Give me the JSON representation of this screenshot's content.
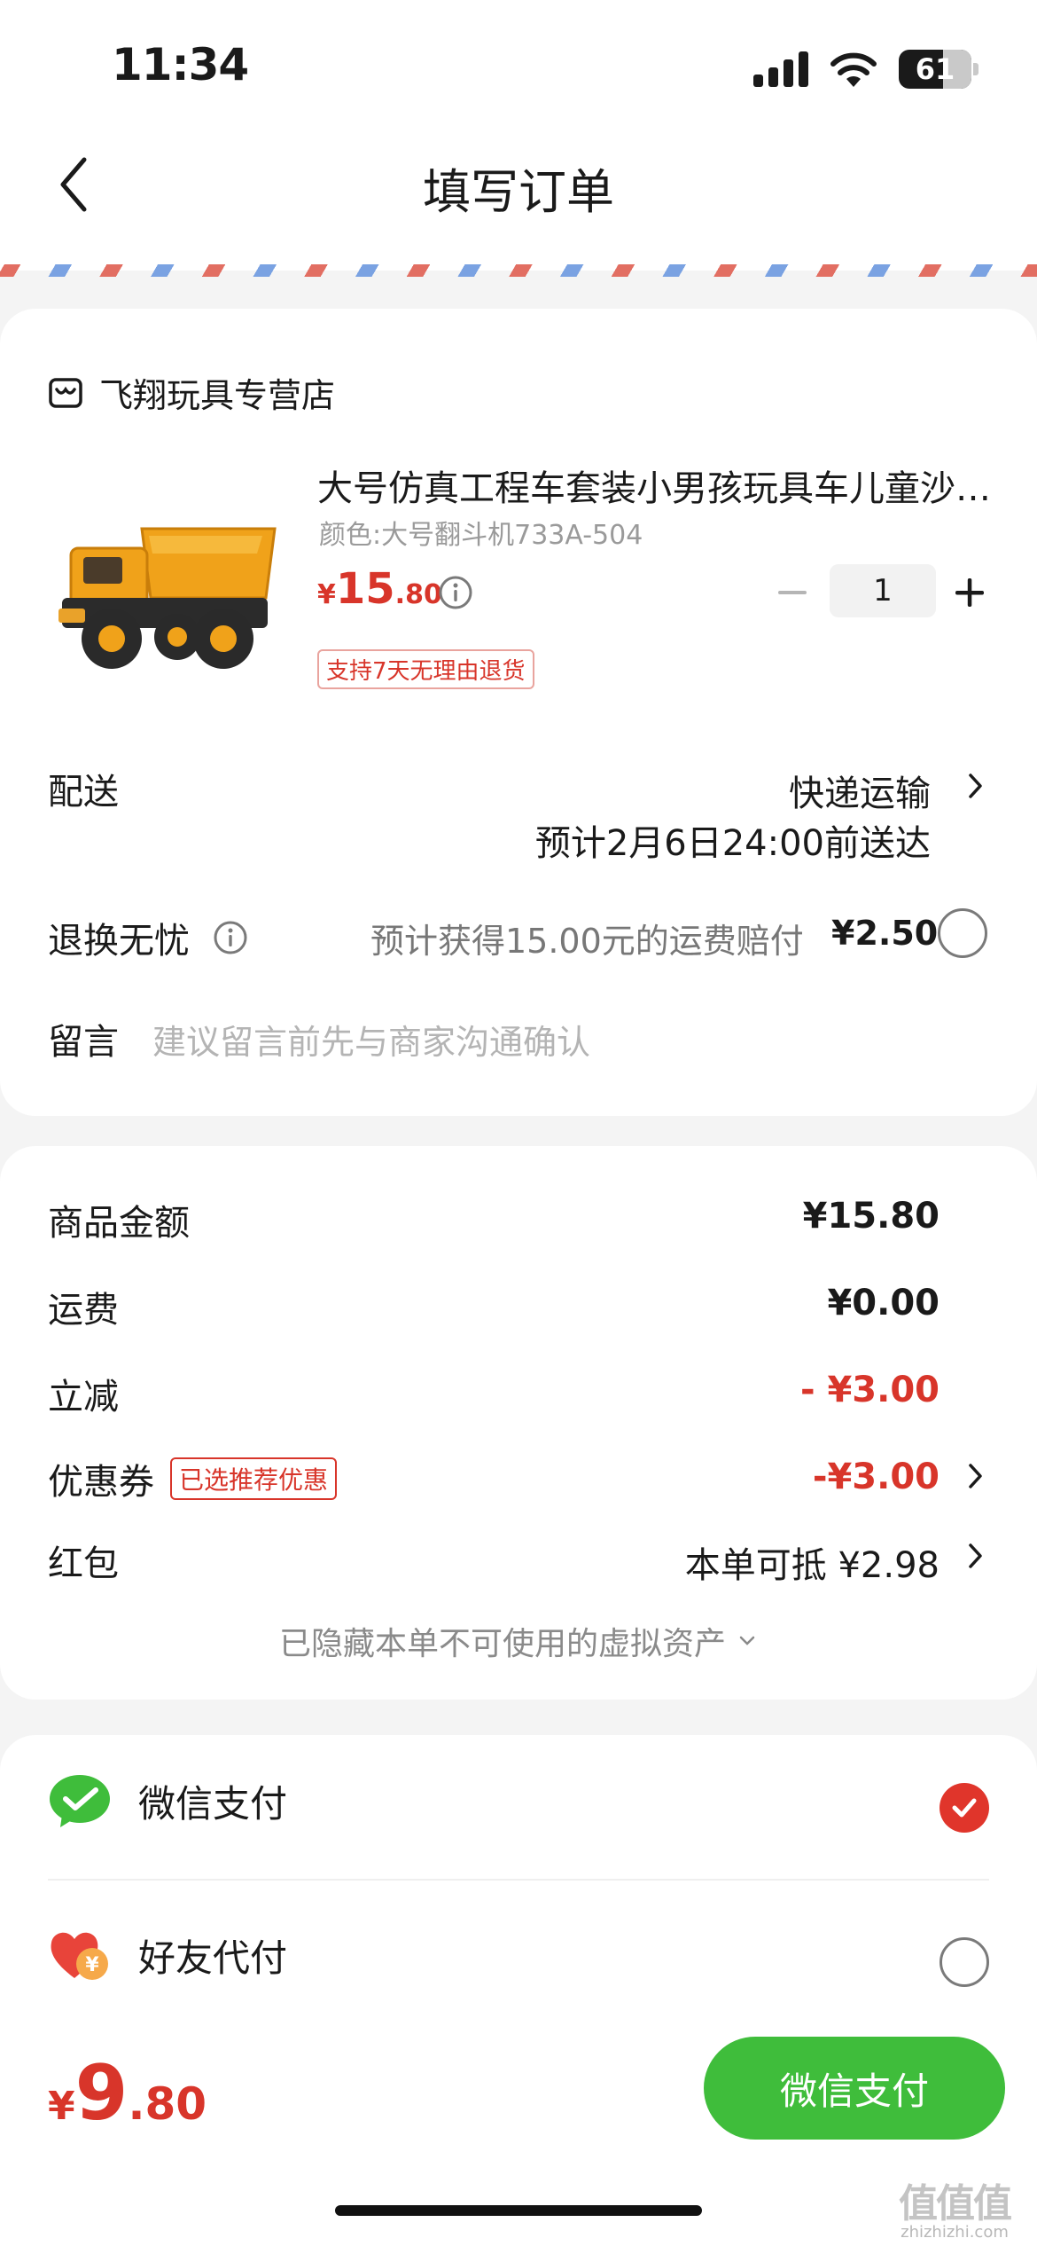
{
  "status_bar": {
    "time": "11:34",
    "battery": "61",
    "battery_level": 0.61
  },
  "header": {
    "title": "填写订单",
    "back_icon": "chevron-left-icon"
  },
  "order": {
    "store_name": "飞翔玩具专营店",
    "store_icon": "store-icon",
    "product": {
      "title": "大号仿真工程车套装小男孩玩具车儿童沙…",
      "variant": "颜色:大号翻斗机733A-504",
      "price_symbol": "¥",
      "price_int": "15",
      "price_dec": ".80",
      "quantity": "1",
      "return_policy": "支持7天无理由退货"
    },
    "delivery": {
      "label": "配送",
      "method": "快递运输",
      "eta": "预计2月6日24:00前送达"
    },
    "return_insurance": {
      "label": "退换无忧",
      "description": "预计获得15.00元的运费赔付",
      "price": "¥2.50"
    },
    "message": {
      "label": "留言",
      "placeholder": "建议留言前先与商家沟通确认"
    }
  },
  "summary": {
    "goods_amount_label": "商品金额",
    "goods_amount": "¥15.80",
    "shipping_label": "运费",
    "shipping": "¥0.00",
    "discount_label": "立减",
    "discount": "- ¥3.00",
    "coupon_label": "优惠券",
    "coupon_tag": "已选推荐优惠",
    "coupon_value": "-¥3.00",
    "redpacket_label": "红包",
    "redpacket_value": "本单可抵 ¥2.98",
    "hidden_assets": "已隐藏本单不可使用的虚拟资产"
  },
  "payment": {
    "wechat_label": "微信支付",
    "friend_label": "好友代付",
    "selected": "wechat"
  },
  "bottom": {
    "total_symbol": "¥",
    "total_int": "9",
    "total_dec": ".80",
    "pay_button": "微信支付"
  },
  "watermark": {
    "logo": "值值值",
    "url": "zhizhizhi.com"
  },
  "colors": {
    "accent_red": "#d8352a",
    "wechat_green": "#3fbd3b"
  }
}
